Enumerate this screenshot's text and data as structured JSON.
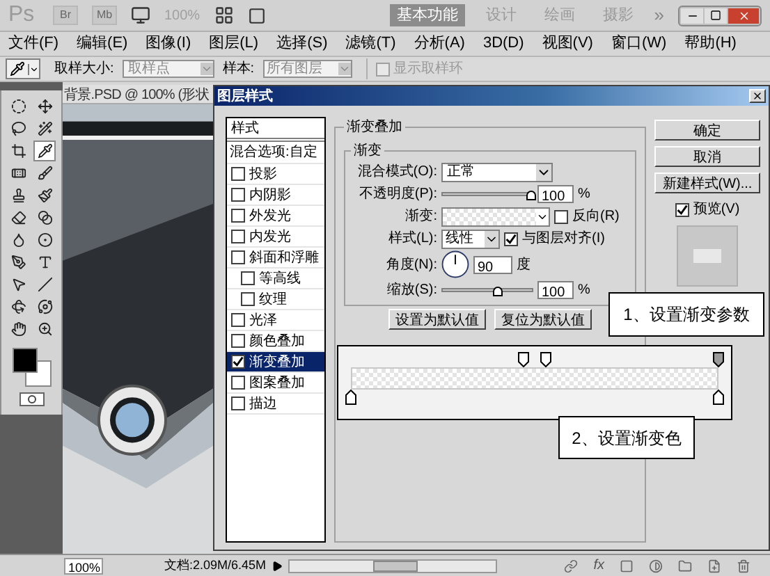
{
  "app_bar": {
    "logo": "Ps",
    "buttons": [
      "Br",
      "Mb"
    ],
    "zoom": "100%",
    "workspaces": [
      {
        "label": "基本功能",
        "selected": true
      },
      {
        "label": "设计",
        "selected": false
      },
      {
        "label": "绘画",
        "selected": false
      },
      {
        "label": "摄影",
        "selected": false
      }
    ],
    "more": "»"
  },
  "menu": [
    "文件(F)",
    "编辑(E)",
    "图像(I)",
    "图层(L)",
    "选择(S)",
    "滤镜(T)",
    "分析(A)",
    "3D(D)",
    "视图(V)",
    "窗口(W)",
    "帮助(H)"
  ],
  "options_bar": {
    "sample_size_label": "取样大小:",
    "sample_size": "取样点",
    "sample_label": "样本:",
    "sample": "所有图层",
    "show_ring": {
      "label": "显示取样环",
      "checked": false,
      "disabled": true
    }
  },
  "toolbox": {
    "tools": [
      {
        "kind": "marquee",
        "selected": false
      },
      {
        "kind": "move",
        "selected": false
      },
      {
        "kind": "lasso",
        "selected": false
      },
      {
        "kind": "wand",
        "selected": false
      },
      {
        "kind": "crop",
        "selected": false
      },
      {
        "kind": "eyedropper",
        "selected": true
      },
      {
        "kind": "healing",
        "selected": false
      },
      {
        "kind": "brush",
        "selected": false
      },
      {
        "kind": "stamp",
        "selected": false
      },
      {
        "kind": "history",
        "selected": false
      },
      {
        "kind": "eraser",
        "selected": false
      },
      {
        "kind": "gradient",
        "selected": false
      },
      {
        "kind": "blur",
        "selected": false
      },
      {
        "kind": "dodge",
        "selected": false
      },
      {
        "kind": "pen",
        "selected": false
      },
      {
        "kind": "type",
        "selected": false
      },
      {
        "kind": "select",
        "selected": false
      },
      {
        "kind": "line",
        "selected": false
      },
      {
        "kind": "rotate3d",
        "selected": false
      },
      {
        "kind": "orbit3d",
        "selected": false
      },
      {
        "kind": "hand",
        "selected": false
      },
      {
        "kind": "zoom",
        "selected": false
      }
    ]
  },
  "document": {
    "tab": "背景.PSD @ 100% (形状"
  },
  "dialog": {
    "title": "图层样式",
    "styles_header": "样式",
    "blending": "混合选项:自定",
    "styles": [
      {
        "label": "投影",
        "checked": false,
        "selected": false
      },
      {
        "label": "内阴影",
        "checked": false,
        "selected": false
      },
      {
        "label": "外发光",
        "checked": false,
        "selected": false
      },
      {
        "label": "内发光",
        "checked": false,
        "selected": false
      },
      {
        "label": "斜面和浮雕",
        "checked": false,
        "selected": false,
        "children": [
          {
            "label": "等高线",
            "checked": false,
            "selected": false
          },
          {
            "label": "纹理",
            "checked": false,
            "selected": false
          }
        ]
      },
      {
        "label": "光泽",
        "checked": false,
        "selected": false
      },
      {
        "label": "颜色叠加",
        "checked": false,
        "selected": false
      },
      {
        "label": "渐变叠加",
        "checked": true,
        "selected": true
      },
      {
        "label": "图案叠加",
        "checked": false,
        "selected": false
      },
      {
        "label": "描边",
        "checked": false,
        "selected": false
      }
    ],
    "section": "渐变叠加",
    "group": "渐变",
    "blend_mode": {
      "label": "混合模式(O):",
      "value": "正常"
    },
    "opacity": {
      "label": "不透明度(P):",
      "level": 1,
      "value": "100",
      "unit": "%"
    },
    "gradient": {
      "label": "渐变:"
    },
    "reverse": {
      "label": "反向(R)",
      "checked": false
    },
    "style": {
      "label": "样式(L):",
      "value": "线性"
    },
    "align": {
      "label": "与图层对齐(I)",
      "checked": true
    },
    "angle": {
      "label": "角度(N):",
      "value": "90",
      "unit": "度"
    },
    "scale": {
      "label": "缩放(S):",
      "level": 0.63,
      "value": "100",
      "unit": "%"
    },
    "default_buttons": [
      "设置为默认值",
      "复位为默认值"
    ],
    "actions": [
      "确定",
      "取消",
      "新建样式(W)..."
    ],
    "preview": {
      "label": "预览(V)",
      "checked": true
    }
  },
  "gradient_editor": {
    "opacity_stops": [
      {
        "level": 0.47,
        "selected": false
      },
      {
        "level": 0.53,
        "selected": false
      },
      {
        "level": 1,
        "selected": true
      }
    ],
    "color_stops": [
      {
        "level": 0,
        "selected": false
      },
      {
        "level": 1,
        "selected": false
      }
    ]
  },
  "callouts": [
    "1、设置渐变参数",
    "2、设置渐变色"
  ],
  "status_bar": {
    "zoom": "100%",
    "doc": "文档:2.09M/6.45M",
    "fx": "fx"
  }
}
